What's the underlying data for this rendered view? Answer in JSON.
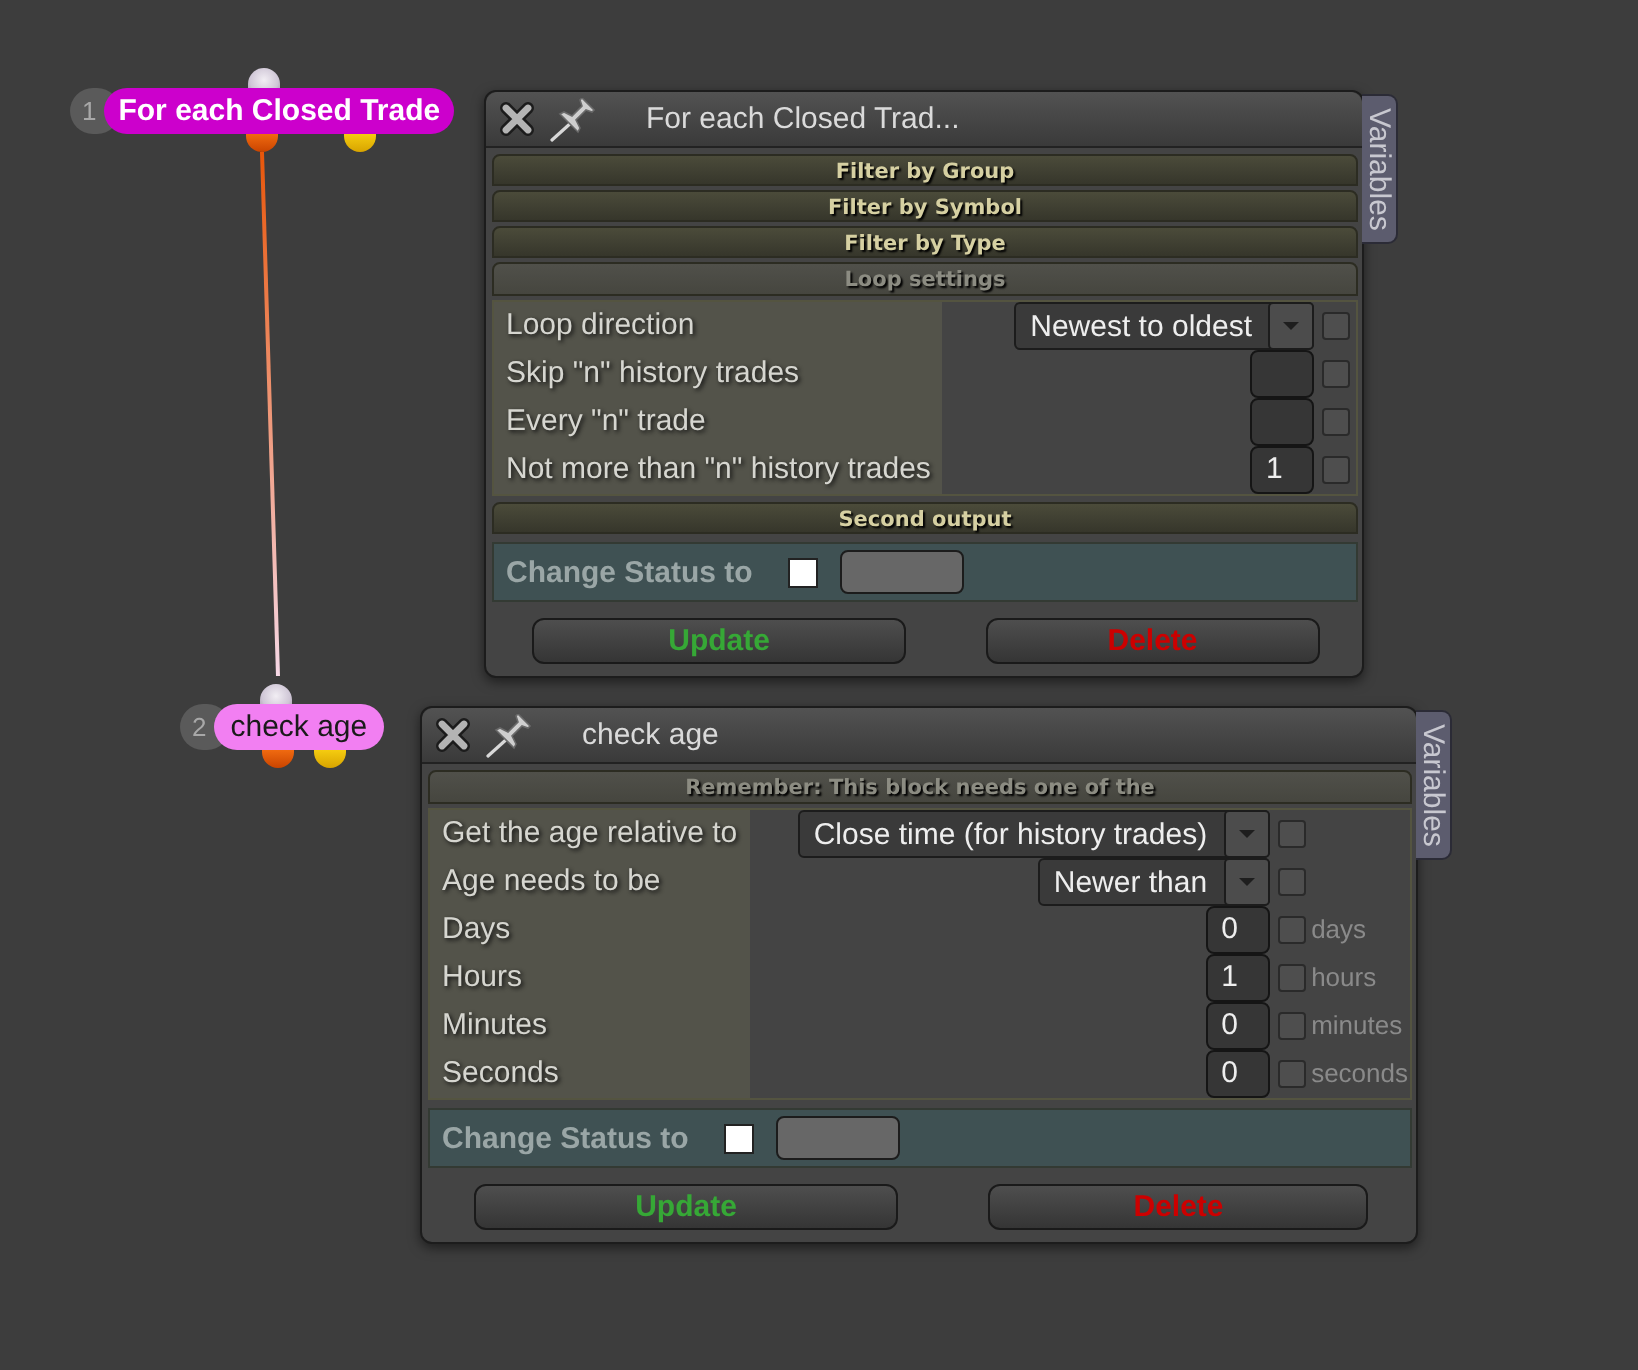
{
  "nodes": [
    {
      "number": "1",
      "label": "For each Closed Trade",
      "color": "#cc00cc",
      "selected": true
    },
    {
      "number": "2",
      "label": "check age",
      "color": "#f27ff2",
      "selected": false
    }
  ],
  "panels": [
    {
      "title": "For each Closed Trad...",
      "side_tab": "Variables",
      "sections": [
        {
          "title": "Filter by Group",
          "expanded": false
        },
        {
          "title": "Filter by Symbol",
          "expanded": false
        },
        {
          "title": "Filter by Type",
          "expanded": false
        },
        {
          "title": "Loop settings",
          "expanded": true,
          "rows": [
            {
              "label": "Loop direction",
              "kind": "dropdown",
              "value": "Newest to oldest",
              "checked": false
            },
            {
              "label": "Skip \"n\" history trades",
              "kind": "number",
              "checked": false
            },
            {
              "label": "Every \"n\" trade",
              "kind": "number",
              "checked": false
            },
            {
              "label": "Not more than \"n\" history trades",
              "kind": "number",
              "value": "1",
              "checked": false
            }
          ]
        },
        {
          "title": "Second output",
          "expanded": false
        }
      ],
      "change_status": {
        "label": "Change Status to",
        "checked": false
      },
      "buttons": [
        {
          "label": "Update",
          "kind": "update"
        },
        {
          "label": "Delete",
          "kind": "delete"
        }
      ]
    },
    {
      "title": "check age",
      "side_tab": "Variables",
      "sections": [
        {
          "title": "Remember: This block needs one of the",
          "expanded": true,
          "rows": [
            {
              "label": "Get the age relative to",
              "kind": "dropdown",
              "value": "Close time (for history trades)",
              "checked": false
            },
            {
              "label": "Age needs to be",
              "kind": "dropdown",
              "value": "Newer than",
              "checked": false
            },
            {
              "label": "Days",
              "kind": "number",
              "value": "0",
              "checked": false,
              "unit": "days"
            },
            {
              "label": "Hours",
              "kind": "number",
              "value": "1",
              "checked": false,
              "unit": "hours"
            },
            {
              "label": "Minutes",
              "kind": "number",
              "value": "0",
              "checked": false,
              "unit": "minutes"
            },
            {
              "label": "Seconds",
              "kind": "number",
              "value": "0",
              "checked": false,
              "unit": "seconds"
            }
          ]
        }
      ],
      "change_status": {
        "label": "Change Status to",
        "checked": false
      },
      "buttons": [
        {
          "label": "Update",
          "kind": "update"
        },
        {
          "label": "Delete",
          "kind": "delete"
        }
      ]
    }
  ]
}
